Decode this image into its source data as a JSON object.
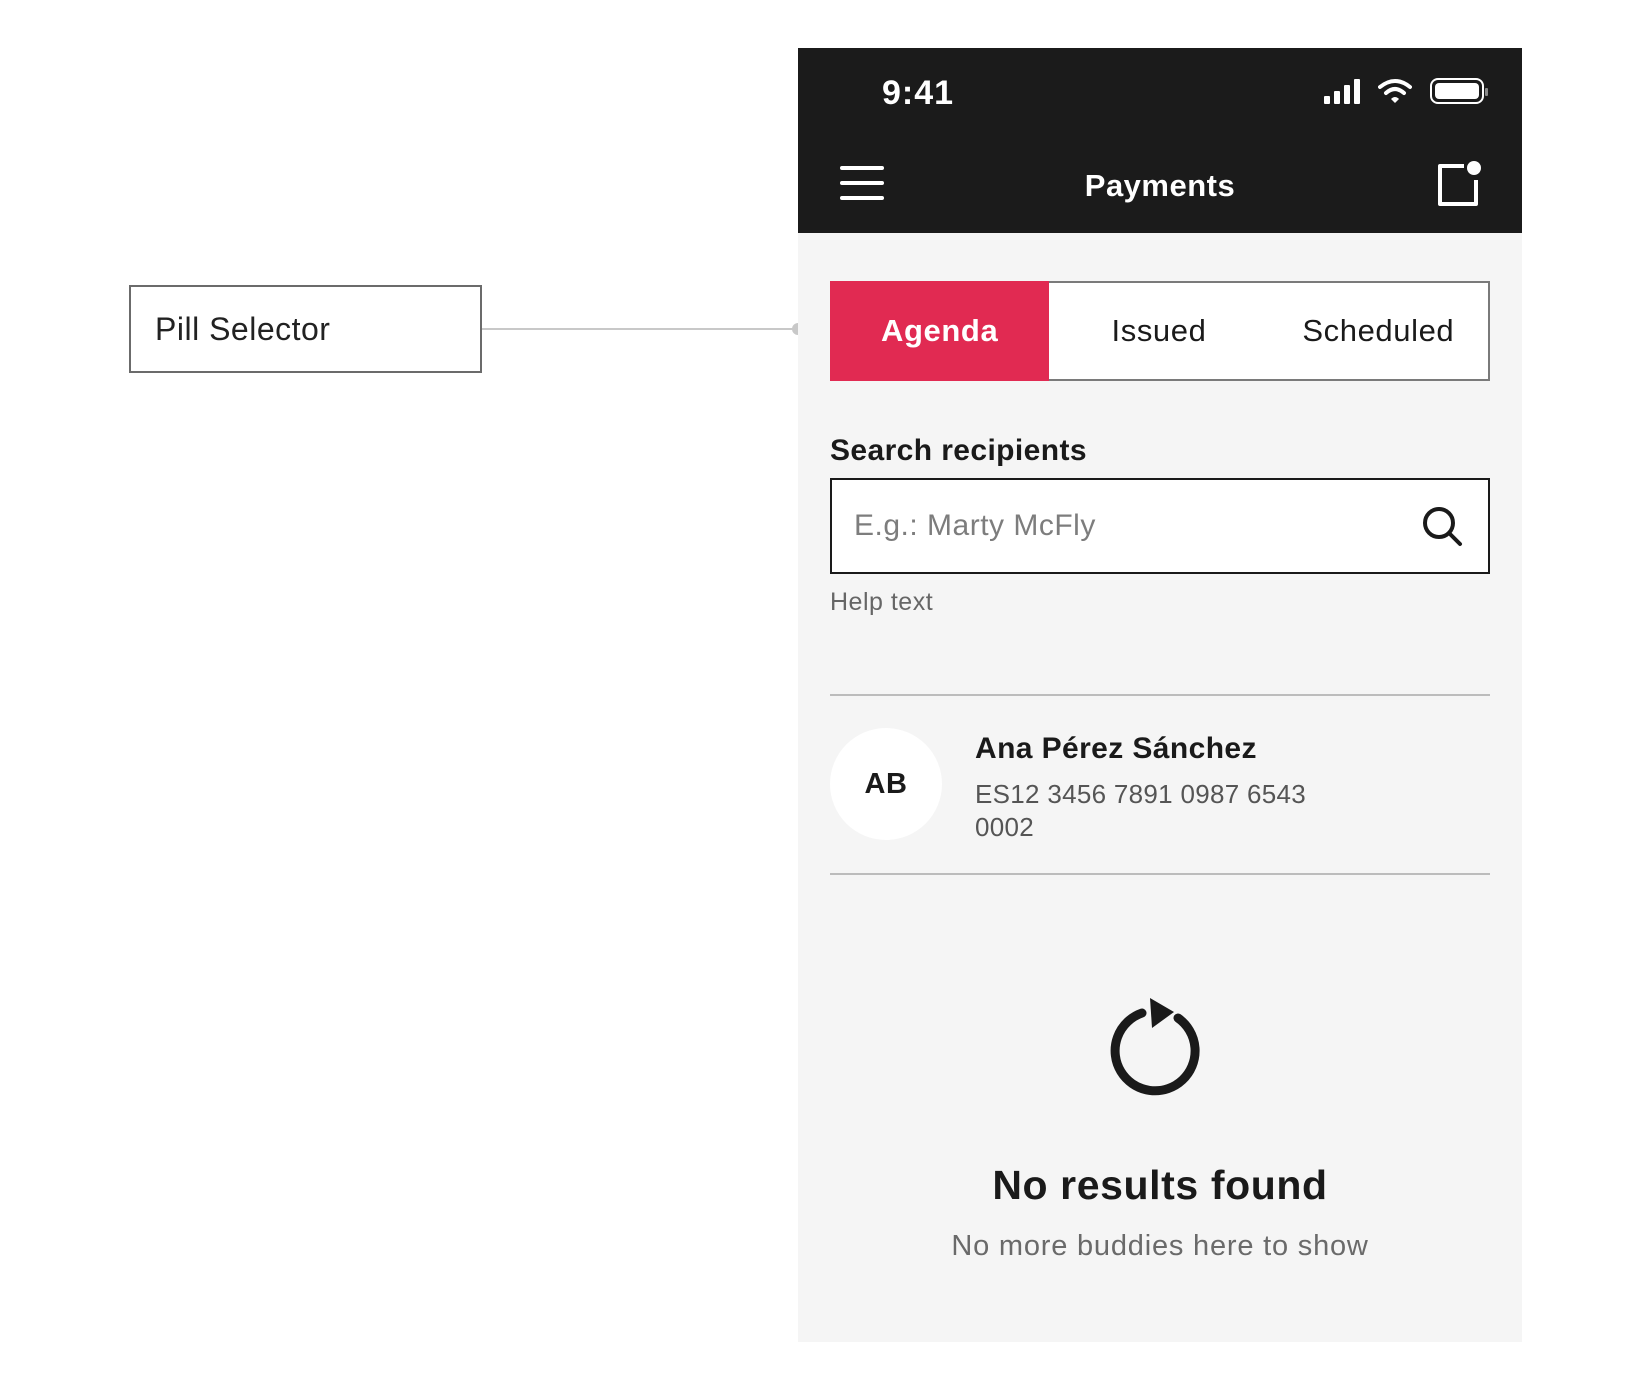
{
  "annotation": {
    "label": "Pill Selector"
  },
  "status_bar": {
    "time": "9:41"
  },
  "header": {
    "title": "Payments",
    "menu_icon": "hamburger-menu-icon",
    "action_icon": "notification-icon"
  },
  "pill_selector": {
    "items": [
      {
        "label": "Agenda",
        "active": true
      },
      {
        "label": "Issued",
        "active": false
      },
      {
        "label": "Scheduled",
        "active": false
      }
    ],
    "active_color": "#e12a52"
  },
  "search": {
    "label": "Search recipients",
    "placeholder": "E.g.: Marty McFly",
    "value": "",
    "help_text": "Help text"
  },
  "recipients": [
    {
      "initials": "AB",
      "name": "Ana Pérez Sánchez",
      "iban": "ES12 3456 7891 0987 6543 0002"
    }
  ],
  "empty_state": {
    "icon": "refresh-icon",
    "title": "No results found",
    "subtitle": "No more buddies here to show"
  },
  "colors": {
    "header_bg": "#1b1b1b",
    "content_bg": "#f5f5f5",
    "accent": "#e12a52"
  }
}
